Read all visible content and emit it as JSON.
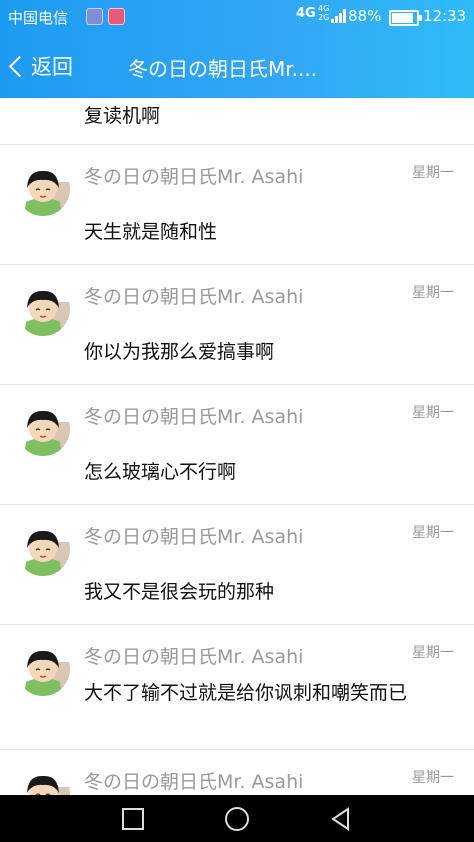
{
  "status_bar": {
    "carrier": "中国电信",
    "network_4g": "4G",
    "network_small": [
      "4G",
      "2G"
    ],
    "battery_percent": "88%",
    "battery_level": 0.88,
    "time": "12:33"
  },
  "header": {
    "back_label": "返回",
    "title": "冬の日の朝日氏Mr...."
  },
  "first_message": "复读机啊",
  "messages": [
    {
      "name": "冬の日の朝日氏Mr. Asahi",
      "time": "星期一",
      "text": "天生就是随和性"
    },
    {
      "name": "冬の日の朝日氏Mr. Asahi",
      "time": "星期一",
      "text": "你以为我那么爱搞事啊"
    },
    {
      "name": "冬の日の朝日氏Mr. Asahi",
      "time": "星期一",
      "text": "怎么玻璃心不行啊"
    },
    {
      "name": "冬の日の朝日氏Mr. Asahi",
      "time": "星期一",
      "text": "我又不是很会玩的那种"
    },
    {
      "name": "冬の日の朝日氏Mr. Asahi",
      "time": "星期一",
      "text": "大不了输不过就是给你讽刺和嘲笑而已"
    },
    {
      "name": "冬の日の朝日氏Mr. Asahi",
      "time": "星期一",
      "text": ""
    }
  ],
  "nav_icons": [
    "recent-apps-icon",
    "home-icon",
    "back-icon"
  ]
}
